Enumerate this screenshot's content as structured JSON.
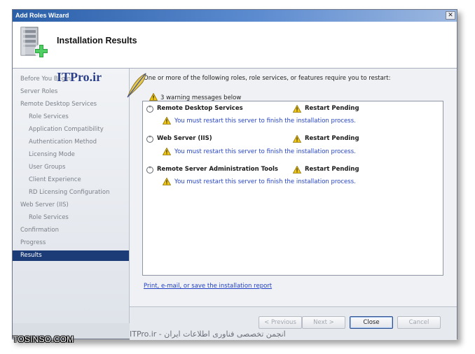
{
  "window": {
    "title": "Add Roles Wizard",
    "close_glyph": "✕"
  },
  "header": {
    "title": "Installation Results",
    "icon": "server-add-icon"
  },
  "sidebar": {
    "items": [
      {
        "label": "Before You Begin",
        "level": 0
      },
      {
        "label": "Server Roles",
        "level": 0
      },
      {
        "label": "Remote Desktop Services",
        "level": 0
      },
      {
        "label": "Role Services",
        "level": 1
      },
      {
        "label": "Application Compatibility",
        "level": 1
      },
      {
        "label": "Authentication Method",
        "level": 1
      },
      {
        "label": "Licensing Mode",
        "level": 1
      },
      {
        "label": "User Groups",
        "level": 1
      },
      {
        "label": "Client Experience",
        "level": 1
      },
      {
        "label": "RD Licensing Configuration",
        "level": 1
      },
      {
        "label": "Web Server (IIS)",
        "level": 0
      },
      {
        "label": "Role Services",
        "level": 1
      },
      {
        "label": "Confirmation",
        "level": 0
      },
      {
        "label": "Progress",
        "level": 0
      },
      {
        "label": "Results",
        "level": 0,
        "active": true
      }
    ]
  },
  "main": {
    "intro": "One or more of the following roles, role services, or features require you to restart:",
    "warning_summary": "3 warning messages below",
    "sections": [
      {
        "name": "Remote Desktop Services",
        "status": "Restart Pending",
        "message": "You must restart this server to finish the installation process."
      },
      {
        "name": "Web Server (IIS)",
        "status": "Restart Pending",
        "message": "You must restart this server to finish the installation process."
      },
      {
        "name": "Remote Server Administration Tools",
        "status": "Restart Pending",
        "message": "You must restart this server to finish the installation process."
      }
    ],
    "report_link": "Print, e-mail, or save the installation report"
  },
  "buttons": {
    "previous": "< Previous",
    "next": "Next >",
    "close": "Close",
    "cancel": "Cancel"
  },
  "watermarks": {
    "itpro": "ITPro.ir",
    "footer": "انجمن تخصصی فناوری اطلاعات ایران - ITPro.ir",
    "site": "TOSINSO.COM"
  },
  "colors": {
    "titlebar": "#2a5fa8",
    "active_step": "#1c3c78",
    "link": "#1f40c5",
    "message": "#2443c8",
    "warning": "#f2c811"
  }
}
